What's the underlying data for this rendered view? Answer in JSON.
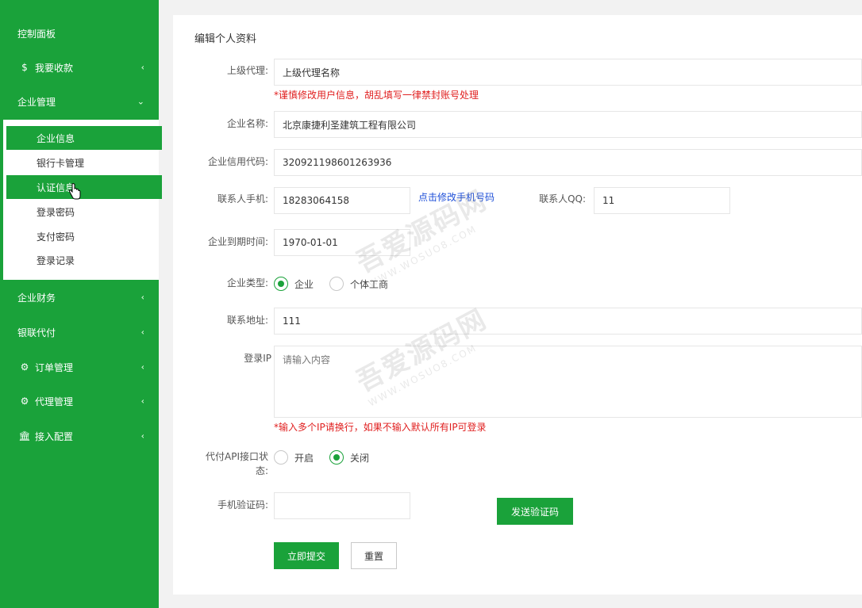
{
  "sidebar": {
    "items": [
      {
        "label": "控制面板",
        "icon": "",
        "chevron": ""
      },
      {
        "label": "我要收款",
        "icon": "$",
        "chevron": "‹"
      },
      {
        "label": "企业管理",
        "icon": "",
        "chevron": "⌄"
      },
      {
        "label": "企业财务",
        "icon": "",
        "chevron": "‹"
      },
      {
        "label": "银联代付",
        "icon": "",
        "chevron": "‹"
      },
      {
        "label": "订单管理",
        "icon": "⚙",
        "chevron": "‹"
      },
      {
        "label": "代理管理",
        "icon": "⚙",
        "chevron": "‹"
      },
      {
        "label": "接入配置",
        "icon": "🏛",
        "chevron": "‹"
      }
    ],
    "sub_items": [
      {
        "label": "企业信息"
      },
      {
        "label": "银行卡管理"
      },
      {
        "label": "认证信息"
      },
      {
        "label": "登录密码"
      },
      {
        "label": "支付密码"
      },
      {
        "label": "登录记录"
      }
    ]
  },
  "form": {
    "title": "编辑个人资料",
    "parent_agent": {
      "label": "上级代理:",
      "value": "上级代理名称"
    },
    "warning": "*谨慎修改用户信息，胡乱填写一律禁封账号处理",
    "company_name": {
      "label": "企业名称:",
      "value": "北京康捷利圣建筑工程有限公司"
    },
    "credit_code": {
      "label": "企业信用代码:",
      "value": "320921198601263936"
    },
    "contact_phone": {
      "label": "联系人手机:",
      "value": "18283064158",
      "link": "点击修改手机号码"
    },
    "contact_qq": {
      "label": "联系人QQ:",
      "value": "11"
    },
    "expire": {
      "label": "企业到期时间:",
      "value": "1970-01-01"
    },
    "company_type": {
      "label": "企业类型:",
      "options": [
        "企业",
        "个体工商"
      ],
      "selected": "企业"
    },
    "address": {
      "label": "联系地址:",
      "value": "111"
    },
    "login_ip": {
      "label": "登录IP",
      "placeholder": "请输入内容",
      "hint": "*输入多个IP请换行，如果不输入默认所有IP可登录"
    },
    "api_status": {
      "label_line1": "代付API接口状",
      "label_line2": "态:",
      "options": [
        "开启",
        "关闭"
      ],
      "selected": "关闭"
    },
    "sms_code": {
      "label": "手机验证码:",
      "value": "",
      "send_button": "发送验证码"
    },
    "submit_button": "立即提交",
    "reset_button": "重置"
  },
  "watermark": {
    "text": "吾爱源码网",
    "domain": "WWW.WOSUO8.COM"
  },
  "colors": {
    "accent": "#1aa23a",
    "warning": "#e02020",
    "link": "#1e4fd8"
  }
}
